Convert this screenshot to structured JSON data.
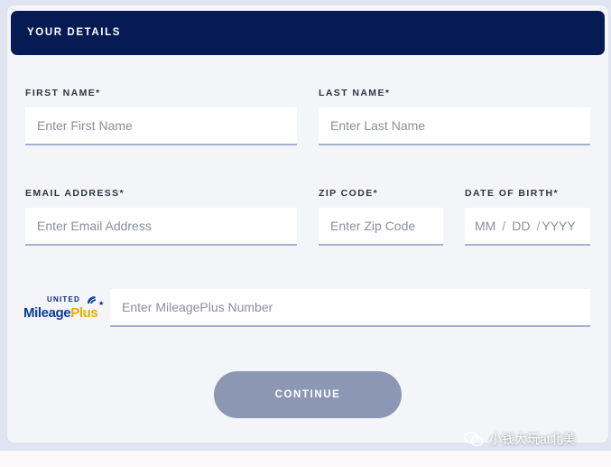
{
  "header": {
    "title": "YOUR DETAILS"
  },
  "fields": {
    "first_name": {
      "label": "FIRST NAME*",
      "placeholder": "Enter First Name"
    },
    "last_name": {
      "label": "LAST NAME*",
      "placeholder": "Enter Last Name"
    },
    "email": {
      "label": "EMAIL ADDRESS*",
      "placeholder": "Enter Email Address"
    },
    "zip": {
      "label": "ZIP CODE*",
      "placeholder": "Enter Zip Code"
    },
    "dob": {
      "label": "DATE OF BIRTH*",
      "month": "MM",
      "day": "DD",
      "year": "YYYY",
      "separator": "/"
    },
    "mileageplus": {
      "placeholder": "Enter MileagePlus Number"
    }
  },
  "logo": {
    "top_text": "UNITED",
    "brand_main": "Mileage",
    "brand_accent": "Plus"
  },
  "continue_button": {
    "label": "CONTINUE"
  },
  "watermark": {
    "text": "小钱大玩at北美"
  },
  "colors": {
    "header_bg": "#061b53",
    "button_bg": "#8c97b3",
    "field_underline": "#a4b0cf",
    "brand_blue": "#0a3c9e",
    "brand_gold": "#f2a900"
  }
}
